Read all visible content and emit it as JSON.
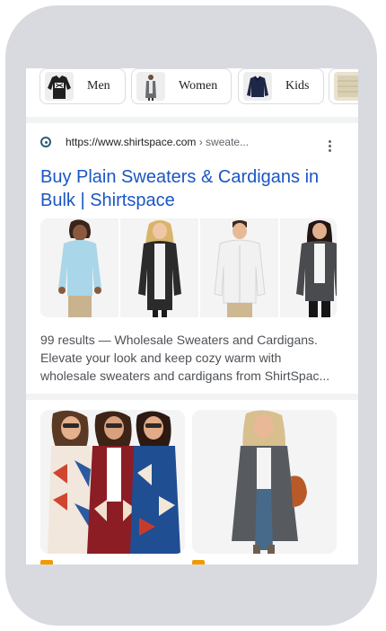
{
  "chips": [
    {
      "label": "Men"
    },
    {
      "label": "Women"
    },
    {
      "label": "Kids"
    }
  ],
  "result": {
    "url_base": "https://www.shirtspace.com",
    "url_path": " › sweate...",
    "title": "Buy Plain Sweaters & Cardigans in Bulk | Shirtspace",
    "snippet": "99 results — Wholesale Sweaters and Cardigans. Elevate your look and keep cozy warm with wholesale sweaters and cardigans from ShirtSpac..."
  },
  "colors": {
    "link": "#1a56c4",
    "frame": "#d9dadf",
    "tag": "#f29900"
  }
}
